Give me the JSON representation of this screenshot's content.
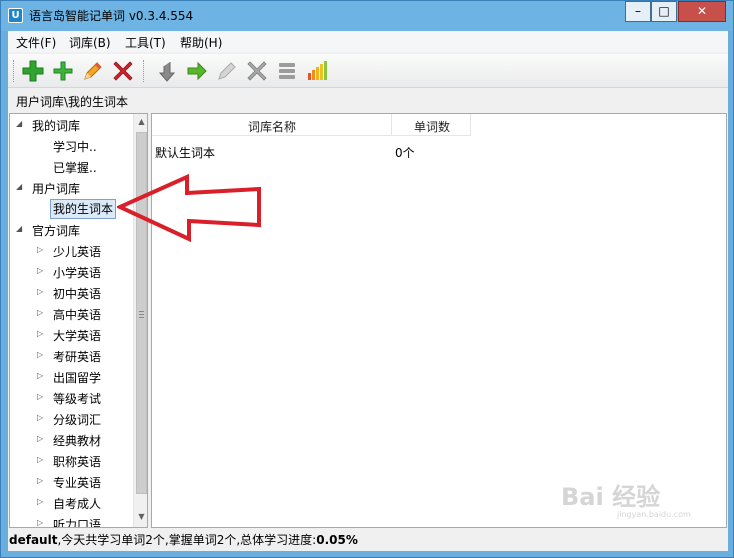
{
  "window": {
    "title": "语言岛智能记单词 v0.3.4.554",
    "app_icon_label": "U",
    "controls": {
      "min": "–",
      "max": "□",
      "close": "✕"
    }
  },
  "menu": [
    {
      "label": "文件(F)"
    },
    {
      "label": "词库(B)"
    },
    {
      "label": "工具(T)"
    },
    {
      "label": "帮助(H)"
    }
  ],
  "toolbar": {
    "icons": [
      "add-green-bold-icon",
      "add-green-icon",
      "pencil-edit-icon",
      "delete-red-icon",
      "down-arrow-gray-icon",
      "right-arrow-green-icon",
      "pencil-gray-icon",
      "delete-gray-icon",
      "list-gray-icon",
      "bar-chart-icon"
    ]
  },
  "path": "用户词库\\我的生词本",
  "tree": {
    "my_lib": {
      "label": "我的词库",
      "children": [
        "学习中..",
        "已掌握.."
      ]
    },
    "user_lib": {
      "label": "用户词库",
      "children": [
        "我的生词本"
      ]
    },
    "official_lib": {
      "label": "官方词库",
      "children": [
        "少儿英语",
        "小学英语",
        "初中英语",
        "高中英语",
        "大学英语",
        "考研英语",
        "出国留学",
        "等级考试",
        "分级词汇",
        "经典教材",
        "职称英语",
        "专业英语",
        "自考成人",
        "听力口语"
      ]
    }
  },
  "list": {
    "headers": {
      "name": "词库名称",
      "count": "单词数"
    },
    "rows": [
      {
        "name": "默认生词本",
        "count": "0个"
      }
    ]
  },
  "status": {
    "user": "default",
    "rest": ",今天共学习单词2个,掌握单词2个,总体学习进度:",
    "progress": "0.05%"
  },
  "watermark": {
    "text": "Bai 经验",
    "sub": "jingyan.baidu.com"
  },
  "colors": {
    "accent_red": "#d9202a",
    "selection": "#dbe9f8",
    "title_bar": "#6db3e4"
  }
}
